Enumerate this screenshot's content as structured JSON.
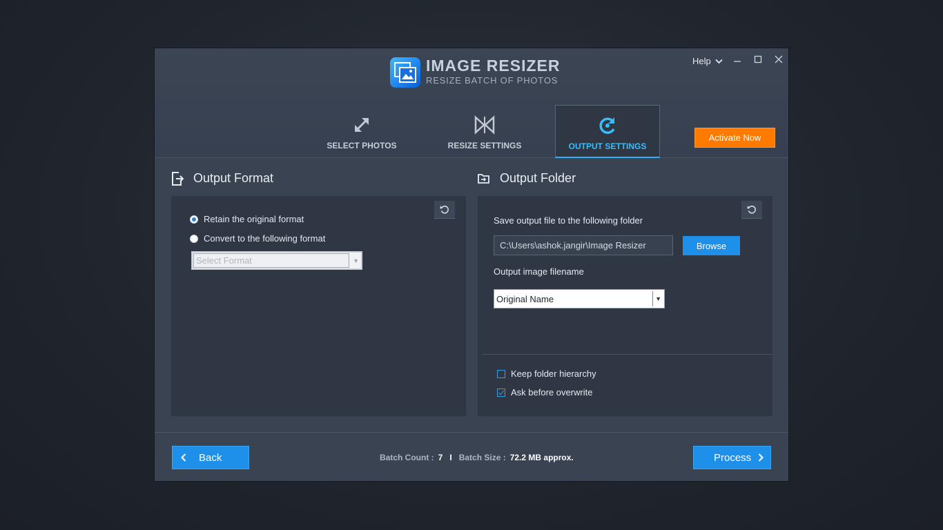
{
  "app": {
    "title": "IMAGE RESIZER",
    "subtitle": "RESIZE BATCH OF PHOTOS",
    "help_label": "Help"
  },
  "tabs": [
    {
      "label": "SELECT PHOTOS",
      "icon": "expand-arrows-icon",
      "active": false
    },
    {
      "label": "RESIZE SETTINGS",
      "icon": "resize-icon",
      "active": false
    },
    {
      "label": "OUTPUT SETTINGS",
      "icon": "refresh-c-icon",
      "active": true
    }
  ],
  "activate_label": "Activate Now",
  "output_format": {
    "title": "Output Format",
    "options": [
      {
        "label": "Retain the original format",
        "selected": true
      },
      {
        "label": "Convert to the following format",
        "selected": false
      }
    ],
    "format_select_placeholder": "Select Format"
  },
  "output_folder": {
    "title": "Output Folder",
    "save_label": "Save output file to the following folder",
    "path_value": "C:\\Users\\ashok.jangir\\Image Resizer",
    "browse_label": "Browse",
    "filename_label": "Output image filename",
    "filename_value": "Original Name",
    "checkboxes": [
      {
        "label": "Keep folder hierarchy",
        "checked": false
      },
      {
        "label": "Ask before overwrite",
        "checked": true
      }
    ]
  },
  "footer": {
    "back_label": "Back",
    "process_label": "Process",
    "batch_count_label": "Batch Count :",
    "batch_count_value": "7",
    "separator": "I",
    "batch_size_label": "Batch Size :",
    "batch_size_value": "72.2 MB approx."
  },
  "colors": {
    "accent_blue": "#1e90ea",
    "active_tab": "#38bdf8",
    "activate_orange": "#ff7a00",
    "window_bg": "#3a4352",
    "panel_bg": "#2f3744"
  }
}
